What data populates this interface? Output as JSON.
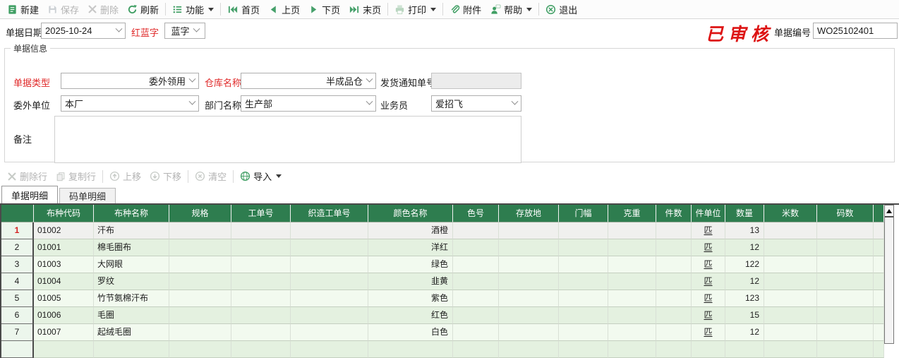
{
  "toolbar": {
    "new": "新建",
    "save": "保存",
    "delete": "删除",
    "refresh": "刷新",
    "functions": "功能",
    "first_page": "首页",
    "prev_page": "上页",
    "next_page": "下页",
    "last_page": "末页",
    "print": "打印",
    "attachment": "附件",
    "help": "帮助",
    "exit": "退出"
  },
  "doc_header": {
    "date_label": "单据日期",
    "date_value": "2025-10-24",
    "red_blue_label": "红蓝字",
    "color_select_value": "蓝字",
    "audit_stamp": "已审核",
    "doc_no_label": "单据编号",
    "doc_no_value": "WO25102401"
  },
  "info_group": {
    "title": "单据信息",
    "doc_type_label": "单据类型",
    "doc_type_value": "委外领用",
    "warehouse_label": "仓库名称",
    "warehouse_value": "半成品仓",
    "delivery_notice_label": "发货通知单号",
    "delivery_notice_value": "",
    "outsource_unit_label": "委外单位",
    "outsource_unit_value": "本厂",
    "department_label": "部门名称",
    "department_value": "生产部",
    "salesman_label": "业务员",
    "salesman_value": "爱招飞",
    "remark_label": "备注",
    "remark_value": ""
  },
  "row_toolbar": {
    "delete_row": "删除行",
    "copy_row": "复制行",
    "move_up": "上移",
    "move_down": "下移",
    "clear": "清空",
    "import": "导入"
  },
  "tabs": [
    {
      "label": "单据明细",
      "active": true
    },
    {
      "label": "码单明细",
      "active": false
    }
  ],
  "table": {
    "selected_row": 1,
    "columns": [
      {
        "label": "",
        "align": "center"
      },
      {
        "label": "布种代码",
        "align": "left"
      },
      {
        "label": "布种名称",
        "align": "left"
      },
      {
        "label": "规格",
        "align": "left"
      },
      {
        "label": "工单号",
        "align": "left"
      },
      {
        "label": "织造工单号",
        "align": "left"
      },
      {
        "label": "颜色名称",
        "align": "right"
      },
      {
        "label": "色号",
        "align": "left"
      },
      {
        "label": "存放地",
        "align": "left"
      },
      {
        "label": "门幅",
        "align": "right"
      },
      {
        "label": "克重",
        "align": "right"
      },
      {
        "label": "件数",
        "align": "right"
      },
      {
        "label": "件单位",
        "align": "center"
      },
      {
        "label": "数量",
        "align": "right"
      },
      {
        "label": "米数",
        "align": "right"
      },
      {
        "label": "码数",
        "align": "right"
      }
    ],
    "rows": [
      [
        "1",
        "01002",
        "汗布",
        "",
        "",
        "",
        "酒橙",
        "",
        "",
        "",
        "",
        "",
        "匹",
        "13",
        "",
        ""
      ],
      [
        "2",
        "01001",
        "棉毛圈布",
        "",
        "",
        "",
        "洋红",
        "",
        "",
        "",
        "",
        "",
        "匹",
        "12",
        "",
        ""
      ],
      [
        "3",
        "01003",
        "大网眼",
        "",
        "",
        "",
        "绿色",
        "",
        "",
        "",
        "",
        "",
        "匹",
        "122",
        "",
        ""
      ],
      [
        "4",
        "01004",
        "罗纹",
        "",
        "",
        "",
        "韭黄",
        "",
        "",
        "",
        "",
        "",
        "匹",
        "12",
        "",
        ""
      ],
      [
        "5",
        "01005",
        "竹节氨棉汗布",
        "",
        "",
        "",
        "紫色",
        "",
        "",
        "",
        "",
        "",
        "匹",
        "123",
        "",
        ""
      ],
      [
        "6",
        "01006",
        "毛圈",
        "",
        "",
        "",
        "红色",
        "",
        "",
        "",
        "",
        "",
        "匹",
        "15",
        "",
        ""
      ],
      [
        "7",
        "01007",
        "起绒毛圈",
        "",
        "",
        "",
        "白色",
        "",
        "",
        "",
        "",
        "",
        "匹",
        "12",
        "",
        ""
      ]
    ]
  },
  "colors": {
    "header_green": "#2e7d4f",
    "icon_green": "#3f9e63",
    "stamp_red": "#dd1414",
    "label_red": "#e02a2a",
    "row_green_dark": "#e4f1e0",
    "row_green_light": "#f2faef",
    "selected_gray": "#f0f0ee"
  }
}
